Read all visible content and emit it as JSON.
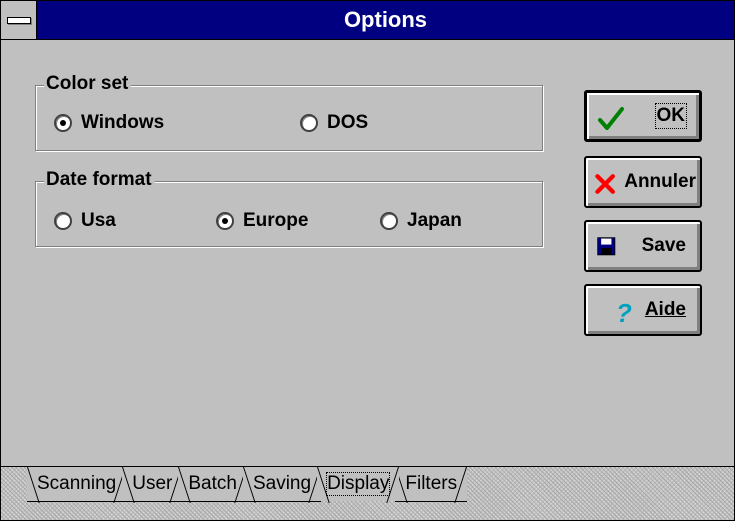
{
  "window": {
    "title": "Options"
  },
  "color_set": {
    "label": "Color set",
    "options": [
      {
        "label": "Windows",
        "checked": true
      },
      {
        "label": "DOS",
        "checked": false
      }
    ]
  },
  "date_format": {
    "label": "Date format",
    "options": [
      {
        "label": "Usa",
        "checked": false
      },
      {
        "label": "Europe",
        "checked": true
      },
      {
        "label": "Japan",
        "checked": false
      }
    ]
  },
  "buttons": {
    "ok": "OK",
    "cancel": "Annuler",
    "save": "Save",
    "help": "Aide"
  },
  "tabs": [
    {
      "label": "Scanning",
      "active": false
    },
    {
      "label": "User",
      "active": false
    },
    {
      "label": "Batch",
      "active": false
    },
    {
      "label": "Saving",
      "active": false
    },
    {
      "label": "Display",
      "active": true
    },
    {
      "label": "Filters",
      "active": false
    }
  ],
  "colors": {
    "titlebar": "#000080",
    "face": "#c0c0c0",
    "ok_check": "#008000",
    "cancel_x": "#ff0000",
    "help_q": "#00a0c0"
  },
  "icons": {
    "ok": "checkmark-icon",
    "cancel": "x-icon",
    "save": "floppy-disk-icon",
    "help": "question-mark-icon"
  }
}
